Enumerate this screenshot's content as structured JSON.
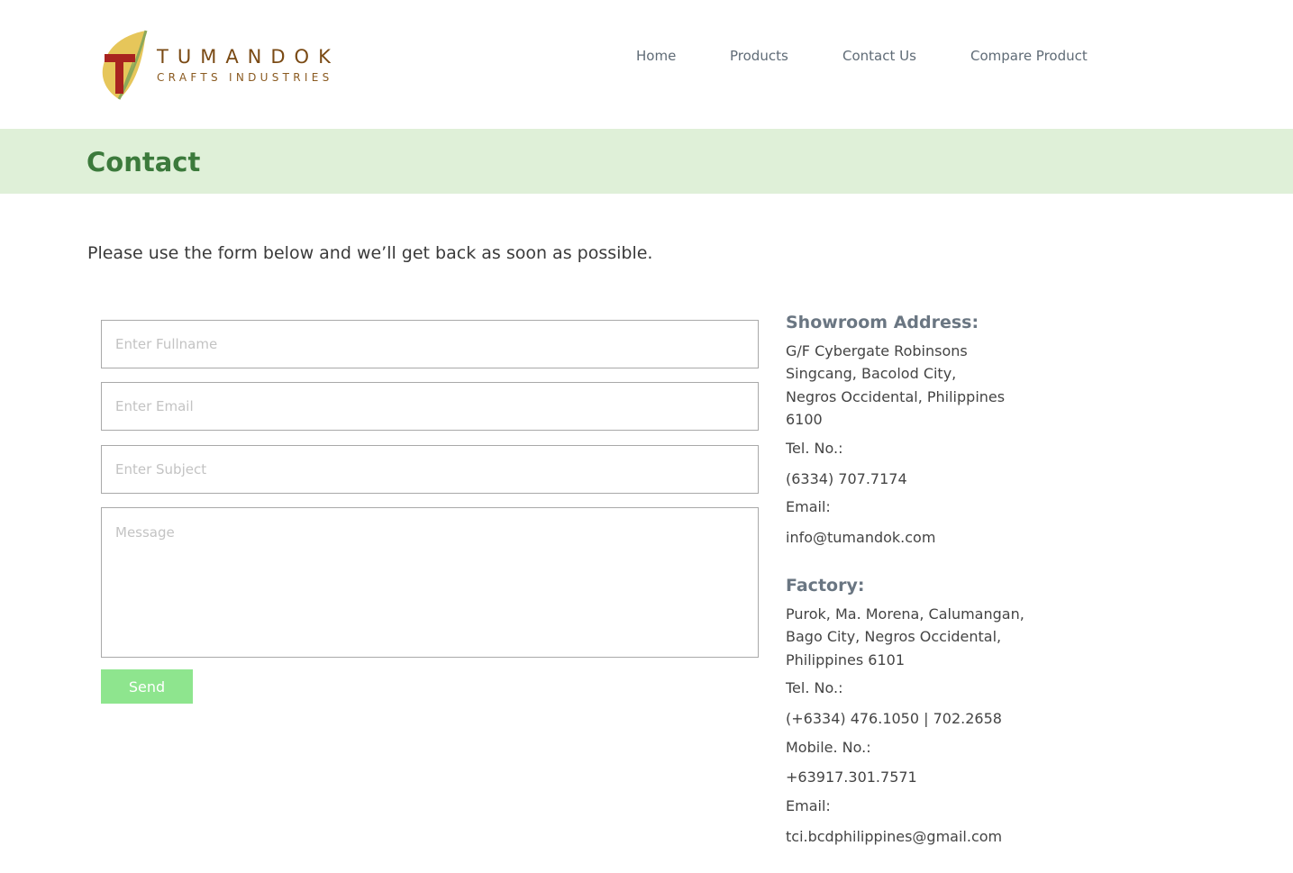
{
  "brand": {
    "name": "TUMANDOK",
    "subtitle": "CRAFTS INDUSTRIES",
    "colors": {
      "leaf_gold": "#e6c65a",
      "leaf_green": "#8ca85a",
      "letter_red": "#a8231f",
      "text_brown": "#7a4a14"
    }
  },
  "nav": {
    "items": [
      {
        "label": "Home"
      },
      {
        "label": "Products"
      },
      {
        "label": "Contact Us"
      },
      {
        "label": "Compare Product"
      }
    ]
  },
  "banner": {
    "title": "Contact",
    "background": "#dff0d8",
    "title_color": "#3c7a3c"
  },
  "intro": "Please use the form below and we’ll get back as soon as possible.",
  "form": {
    "fullname_placeholder": "Enter Fullname",
    "email_placeholder": "Enter Email",
    "subject_placeholder": "Enter Subject",
    "message_placeholder": "Message",
    "send_label": "Send",
    "send_color": "#8ee58e"
  },
  "showroom": {
    "heading": "Showroom Address:",
    "address_lines": [
      "G/F Cybergate Robinsons",
      "Singcang, Bacolod City,",
      "Negros Occidental, Philippines",
      "6100"
    ],
    "tel_label": "Tel. No.:",
    "tel": "(6334) 707.7174",
    "email_label": "Email:",
    "email": "info@tumandok.com"
  },
  "factory": {
    "heading": "Factory:",
    "address_lines": [
      "Purok, Ma. Morena, Calumangan,",
      "Bago City, Negros Occidental,",
      "Philippines 6101"
    ],
    "tel_label": "Tel. No.:",
    "tel": "(+6334) 476.1050 | 702.2658",
    "mobile_label": "Mobile. No.:",
    "mobile": "+63917.301.7571",
    "email_label": "Email:",
    "email": "tci.bcdphilippines@gmail.com"
  }
}
